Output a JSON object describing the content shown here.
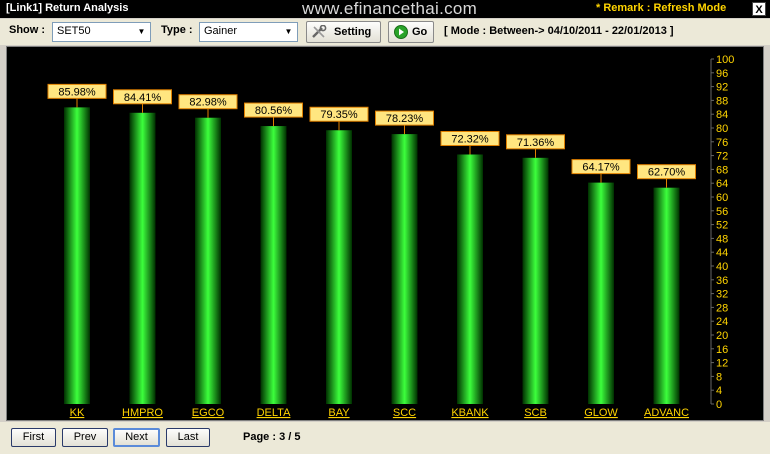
{
  "window": {
    "title": "[Link1] Return Analysis",
    "watermark": "www.efinancethai.com",
    "remark": "* Remark : Refresh Mode",
    "close_label": "X"
  },
  "toolbar": {
    "show_label": "Show :",
    "show_value": "SET50",
    "type_label": "Type :",
    "type_value": "Gainer",
    "setting_label": "Setting",
    "go_label": "Go",
    "mode_text": "[ Mode : Between-> 04/10/2011 - 22/01/2013 ]"
  },
  "footer": {
    "first_label": "First",
    "prev_label": "Prev",
    "next_label": "Next",
    "last_label": "Last",
    "page_text": "Page : 3 / 5"
  },
  "colors": {
    "bar_edge": "#003000",
    "bar_center": "#3cff3c",
    "label_bg": "#ffe680",
    "label_border": "#e08000",
    "tick_label": "#ffd400",
    "grid": "#1a1a1a"
  },
  "chart_data": {
    "type": "bar",
    "categories": [
      "KK",
      "HMPRO",
      "EGCO",
      "DELTA",
      "BAY",
      "SCC",
      "KBANK",
      "SCB",
      "GLOW",
      "ADVANC"
    ],
    "values": [
      85.98,
      84.41,
      82.98,
      80.56,
      79.35,
      78.23,
      72.32,
      71.36,
      64.17,
      62.7
    ],
    "data_labels": [
      "85.98%",
      "84.41%",
      "82.98%",
      "80.56%",
      "79.35%",
      "78.23%",
      "72.32%",
      "71.36%",
      "64.17%",
      "62.70%"
    ],
    "ylim": [
      0,
      100
    ],
    "yticks": [
      0,
      4,
      8,
      12,
      16,
      20,
      24,
      28,
      32,
      36,
      40,
      44,
      48,
      52,
      56,
      60,
      64,
      68,
      72,
      76,
      80,
      84,
      88,
      92,
      96,
      100
    ],
    "y_axis_side": "right",
    "grid": false
  }
}
